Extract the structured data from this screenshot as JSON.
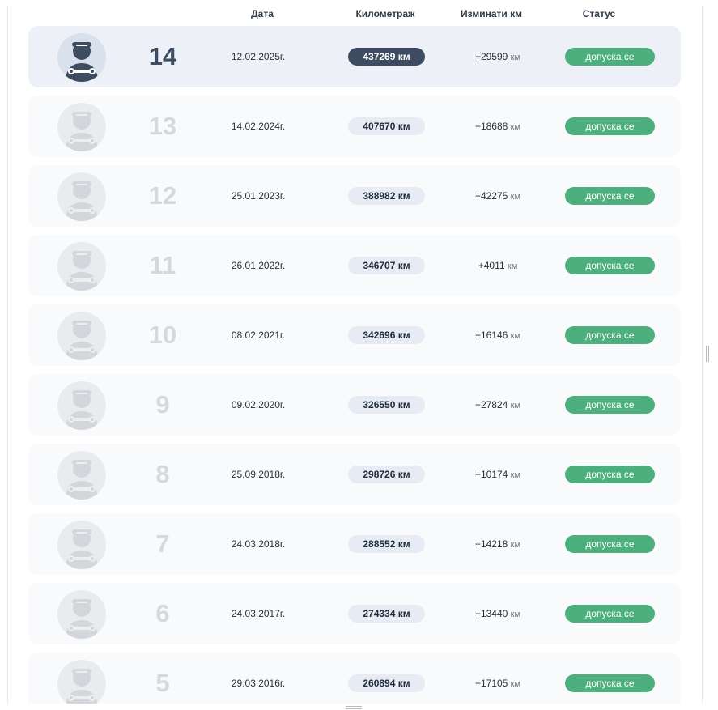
{
  "header": {
    "date": "Дата",
    "mileage": "Километраж",
    "changed": "Изминати км",
    "status": "Статус"
  },
  "colors": {
    "status_ok": "#4caf7d",
    "active_accent": "#3e4c61",
    "pill_bg": "#e6ebf4"
  },
  "rows": [
    {
      "num": "14",
      "date": "12.02.2025г.",
      "mileage": "437269 км",
      "change": "+29599",
      "unit": "км",
      "status": "допуска се",
      "active": true,
      "icon": "mechanic-avatar-icon"
    },
    {
      "num": "13",
      "date": "14.02.2024г.",
      "mileage": "407670 км",
      "change": "+18688",
      "unit": "км",
      "status": "допуска се",
      "active": false,
      "icon": "mechanic-avatar-icon"
    },
    {
      "num": "12",
      "date": "25.01.2023г.",
      "mileage": "388982 км",
      "change": "+42275",
      "unit": "км",
      "status": "допуска се",
      "active": false,
      "icon": "mechanic-avatar-icon"
    },
    {
      "num": "11",
      "date": "26.01.2022г.",
      "mileage": "346707 км",
      "change": "+4011",
      "unit": "км",
      "status": "допуска се",
      "active": false,
      "icon": "mechanic-avatar-icon"
    },
    {
      "num": "10",
      "date": "08.02.2021г.",
      "mileage": "342696 км",
      "change": "+16146",
      "unit": "км",
      "status": "допуска се",
      "active": false,
      "icon": "mechanic-avatar-icon"
    },
    {
      "num": "9",
      "date": "09.02.2020г.",
      "mileage": "326550 км",
      "change": "+27824",
      "unit": "км",
      "status": "допуска се",
      "active": false,
      "icon": "mechanic-avatar-icon"
    },
    {
      "num": "8",
      "date": "25.09.2018г.",
      "mileage": "298726 км",
      "change": "+10174",
      "unit": "км",
      "status": "допуска се",
      "active": false,
      "icon": "mechanic-avatar-icon"
    },
    {
      "num": "7",
      "date": "24.03.2018г.",
      "mileage": "288552 км",
      "change": "+14218",
      "unit": "км",
      "status": "допуска се",
      "active": false,
      "icon": "mechanic-avatar-icon"
    },
    {
      "num": "6",
      "date": "24.03.2017г.",
      "mileage": "274334 км",
      "change": "+13440",
      "unit": "км",
      "status": "допуска се",
      "active": false,
      "icon": "mechanic-avatar-icon"
    },
    {
      "num": "5",
      "date": "29.03.2016г.",
      "mileage": "260894 км",
      "change": "+17105",
      "unit": "км",
      "status": "допуска се",
      "active": false,
      "icon": "mechanic-avatar-icon"
    }
  ]
}
